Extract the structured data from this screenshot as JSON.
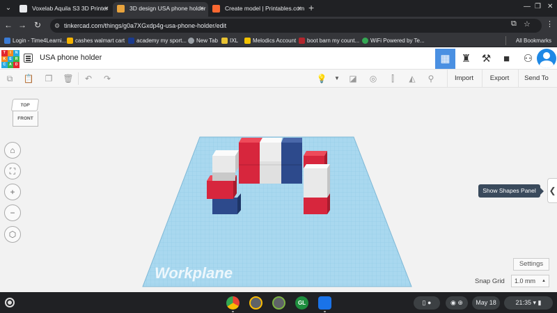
{
  "browser": {
    "tabs": [
      {
        "title": "Voxelab Aquila S3 3D Printer",
        "favicon_color": "#e8eaed"
      },
      {
        "title": "3D design USA phone holder",
        "favicon_color": "#e8a33d"
      },
      {
        "title": "Create model | Printables.com",
        "favicon_color": "#fa6831"
      }
    ],
    "url": "tinkercad.com/things/g0a7XGxdp4g-usa-phone-holder/edit",
    "bookmarks": [
      {
        "label": "Login - Time4Learni...",
        "color": "#3a7bd5"
      },
      {
        "label": "cashes walmart cart",
        "color": "#f5b400"
      },
      {
        "label": "academy my sport...",
        "color": "#1a3b8f"
      },
      {
        "label": "New Tab",
        "color": "#9aa0a6"
      },
      {
        "label": "IXL",
        "color": "#e8c232"
      },
      {
        "label": "Melodics Account",
        "color": "#f2c200"
      },
      {
        "label": "boot barn my count...",
        "color": "#b3262d"
      },
      {
        "label": "WiFi Powered by Te...",
        "color": "#34a853"
      }
    ],
    "all_bookmarks": "All Bookmarks"
  },
  "app": {
    "logo_letters": [
      "T",
      "I",
      "N",
      "K",
      "E",
      "R",
      "C",
      "A",
      "D"
    ],
    "design_title": "USA phone holder",
    "toolbar": {
      "import": "Import",
      "export": "Export",
      "send_to": "Send To"
    },
    "viewcube": {
      "top": "TOP",
      "front": "FRONT"
    },
    "workplane": "Workplane",
    "tooltip": "Show Shapes Panel",
    "settings": "Settings",
    "snap_grid_label": "Snap Grid",
    "snap_grid_value": "1.0 mm"
  },
  "shelf": {
    "apps": [
      {
        "name": "chrome",
        "color": "#ea4335"
      },
      {
        "name": "photos",
        "color": "#fbbc04"
      },
      {
        "name": "game",
        "color": "#7cb342"
      }
    ],
    "gl_label": "GL",
    "date": "May 18",
    "time": "21:35"
  },
  "colors": {
    "red": "#d7263d",
    "white": "#e9e9e9",
    "blue": "#2d4a8c",
    "workplane": "#a9d8ef",
    "accent": "#4a90e2"
  }
}
